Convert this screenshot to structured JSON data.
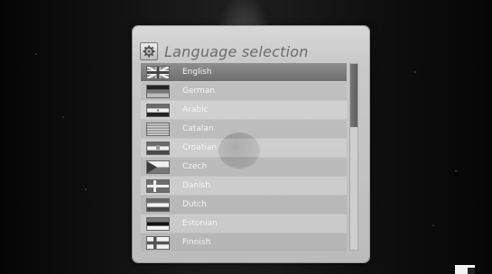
{
  "dialog": {
    "title": "Language selection",
    "title_icon": "gear-icon"
  },
  "languages": [
    {
      "label": "English",
      "flag": "uk-flag-icon",
      "selected": true
    },
    {
      "label": "German",
      "flag": "germany-flag-icon",
      "selected": false
    },
    {
      "label": "Arabic",
      "flag": "egypt-flag-icon",
      "selected": false
    },
    {
      "label": "Catalan",
      "flag": "catalonia-flag-icon",
      "selected": false
    },
    {
      "label": "Croatian",
      "flag": "croatia-flag-icon",
      "selected": false
    },
    {
      "label": "Czech",
      "flag": "czech-flag-icon",
      "selected": false
    },
    {
      "label": "Danish",
      "flag": "denmark-flag-icon",
      "selected": false
    },
    {
      "label": "Dutch",
      "flag": "netherlands-flag-icon",
      "selected": false
    },
    {
      "label": "Estonian",
      "flag": "estonia-flag-icon",
      "selected": false
    },
    {
      "label": "Finnish",
      "flag": "finland-flag-icon",
      "selected": false
    }
  ],
  "colors": {
    "selected_row": "#7d7d7d",
    "panel": "#c8c8c8",
    "title_text": "#6c6c6c"
  }
}
